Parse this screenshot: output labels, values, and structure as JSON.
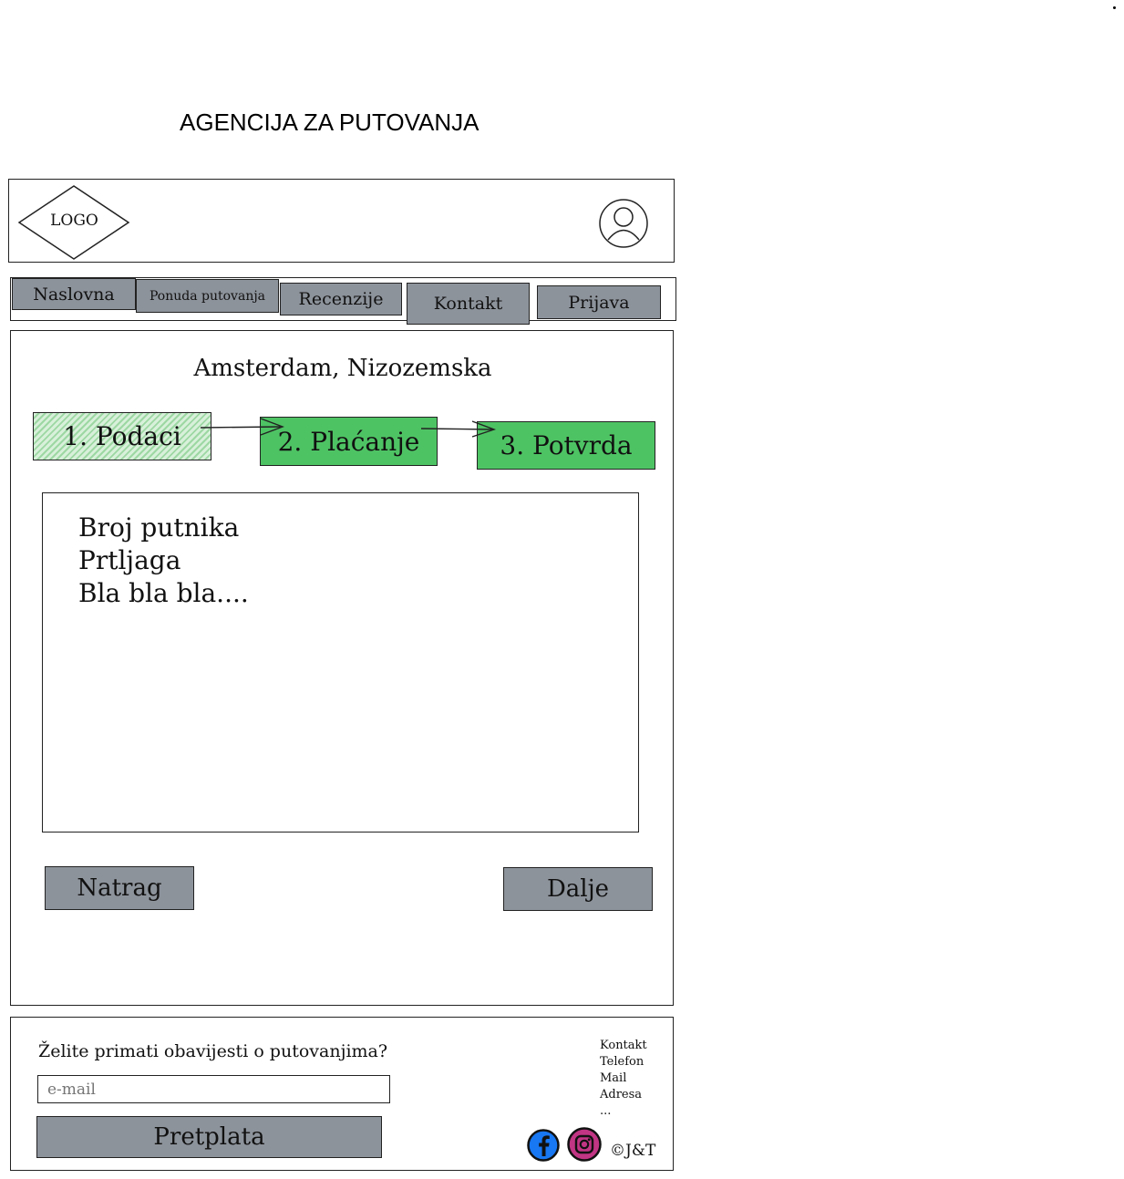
{
  "page": {
    "title": "AGENCIJA ZA PUTOVANJA"
  },
  "header": {
    "logo_text": "LOGO",
    "avatar_icon": "user-avatar-icon"
  },
  "nav": {
    "items": [
      {
        "label": "Naslovna"
      },
      {
        "label": "Ponuda putovanja"
      },
      {
        "label": "Recenzije"
      },
      {
        "label": "Kontakt"
      },
      {
        "label": "Prijava"
      }
    ]
  },
  "main": {
    "destination": "Amsterdam, Nizozemska",
    "steps": [
      {
        "label": "1. Podaci",
        "status": "done"
      },
      {
        "label": "2. Plaćanje",
        "status": "pending"
      },
      {
        "label": "3. Potvrda",
        "status": "pending"
      }
    ],
    "form_lines": [
      "Broj putnika",
      "Prtljaga",
      "Bla bla bla...."
    ],
    "back_label": "Natrag",
    "next_label": "Dalje"
  },
  "footer": {
    "newsletter_prompt": "Želite primati obavijesti o putovanjima?",
    "email_placeholder": "e-mail",
    "subscribe_label": "Pretplata",
    "links": [
      "Kontakt",
      "Telefon",
      "Mail",
      "Adresa",
      "..."
    ],
    "social_icons": [
      "facebook-icon",
      "instagram-icon"
    ],
    "copyright": "©J&T"
  },
  "colors": {
    "step_active": "#4ec364",
    "button_grey": "#8d939b",
    "facebook": "#1877f2",
    "instagram": "#c13584"
  }
}
